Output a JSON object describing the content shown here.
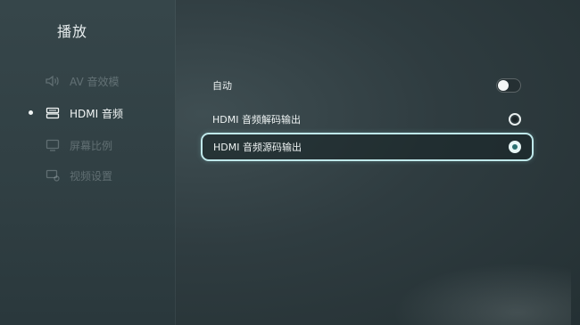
{
  "header": {
    "title": "播放"
  },
  "sidebar": {
    "items": [
      {
        "label": "AV 音效模",
        "icon": "speaker-icon",
        "active": false
      },
      {
        "label": "HDMI 音频",
        "icon": "hdmi-icon",
        "active": true
      },
      {
        "label": "屏幕比例",
        "icon": "monitor-icon",
        "active": false
      },
      {
        "label": "视频设置",
        "icon": "display-settings-icon",
        "active": false
      }
    ]
  },
  "options": {
    "auto": {
      "label": "自动",
      "state": "off"
    },
    "decode": {
      "label": "HDMI 音频解码输出",
      "selected": false
    },
    "source": {
      "label": "HDMI 音频源码输出",
      "selected": true
    }
  },
  "colors": {
    "focus_border": "#bfe8ea",
    "selected_radio_dot": "#2a6f70",
    "text": "#eef3f3"
  }
}
